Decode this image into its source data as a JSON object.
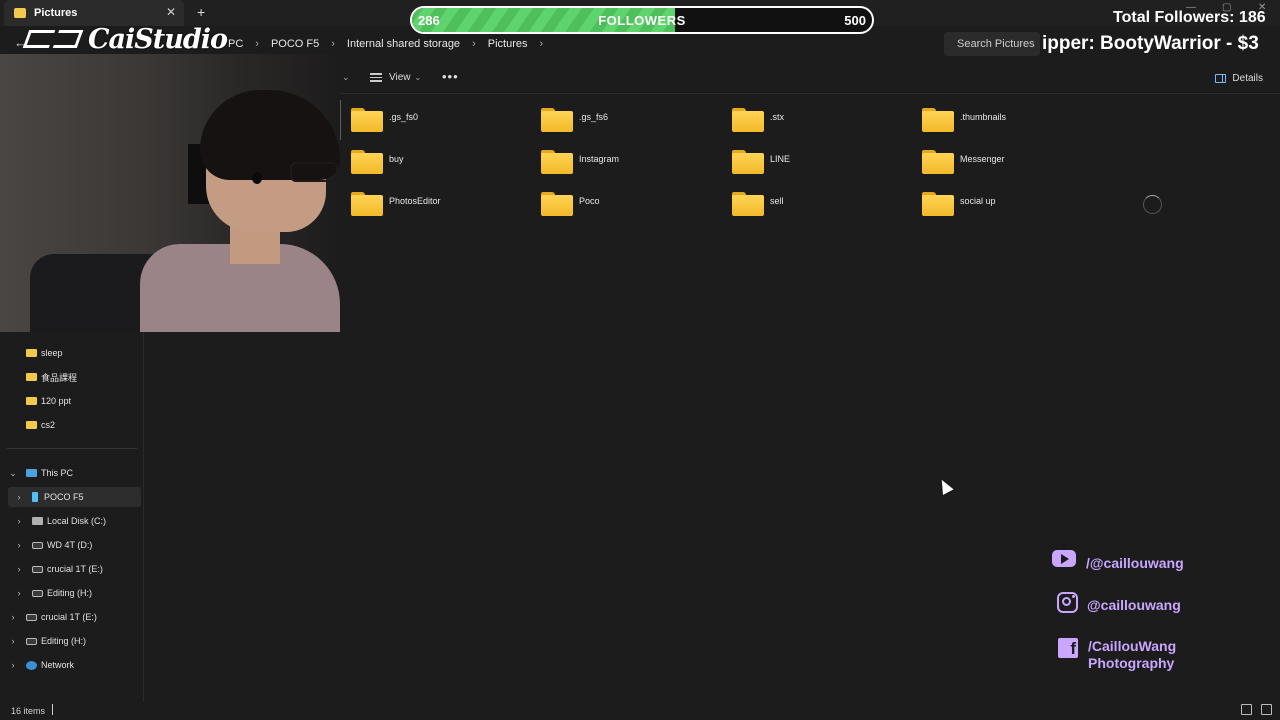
{
  "window": {
    "tab_title": "Pictures",
    "new_tab": "+",
    "close": "✕"
  },
  "address": {
    "crumbs": [
      "PC",
      "POCO F5",
      "Internal shared storage",
      "Pictures"
    ],
    "search_placeholder": "Search Pictures"
  },
  "toolbar": {
    "view_label": "View",
    "more": "•••",
    "details_label": "Details"
  },
  "folders": [
    ".gs_fs0",
    ".gs_fs6",
    ".stx",
    ".thumbnails",
    "buy",
    "Instagram",
    "LINE",
    "Messenger",
    "PhotosEditor",
    "Poco",
    "sell",
    "social up"
  ],
  "sidebar": {
    "quick": [
      "sleep",
      "食品課程",
      "120 ppt",
      "cs2"
    ],
    "this_pc": "This PC",
    "drives": [
      "POCO F5",
      "Local Disk (C:)",
      "WD 4T (D:)",
      "crucial 1T (E:)",
      "Editing (H:)"
    ],
    "extra": [
      "crucial 1T (E:)",
      "Editing (H:)",
      "Network"
    ]
  },
  "status": {
    "item_count": "16 items"
  },
  "overlay": {
    "logo_text": "CaiStudio",
    "followers_current": "286",
    "followers_label": "FOLLOWERS",
    "followers_goal": "500",
    "followers_progress": 0.572,
    "total_followers": "Total Followers: 186",
    "ticker": "ipper: BootyWarrior - $3",
    "youtube": "/@caillouwang",
    "instagram": "@caillouwang",
    "facebook_line1": "/CaillouWang",
    "facebook_line2": "Photography"
  },
  "colors": {
    "progress_green": "#5fd46c",
    "social_purple": "#c9a6ff",
    "folder_yellow": "#f2c94c"
  }
}
